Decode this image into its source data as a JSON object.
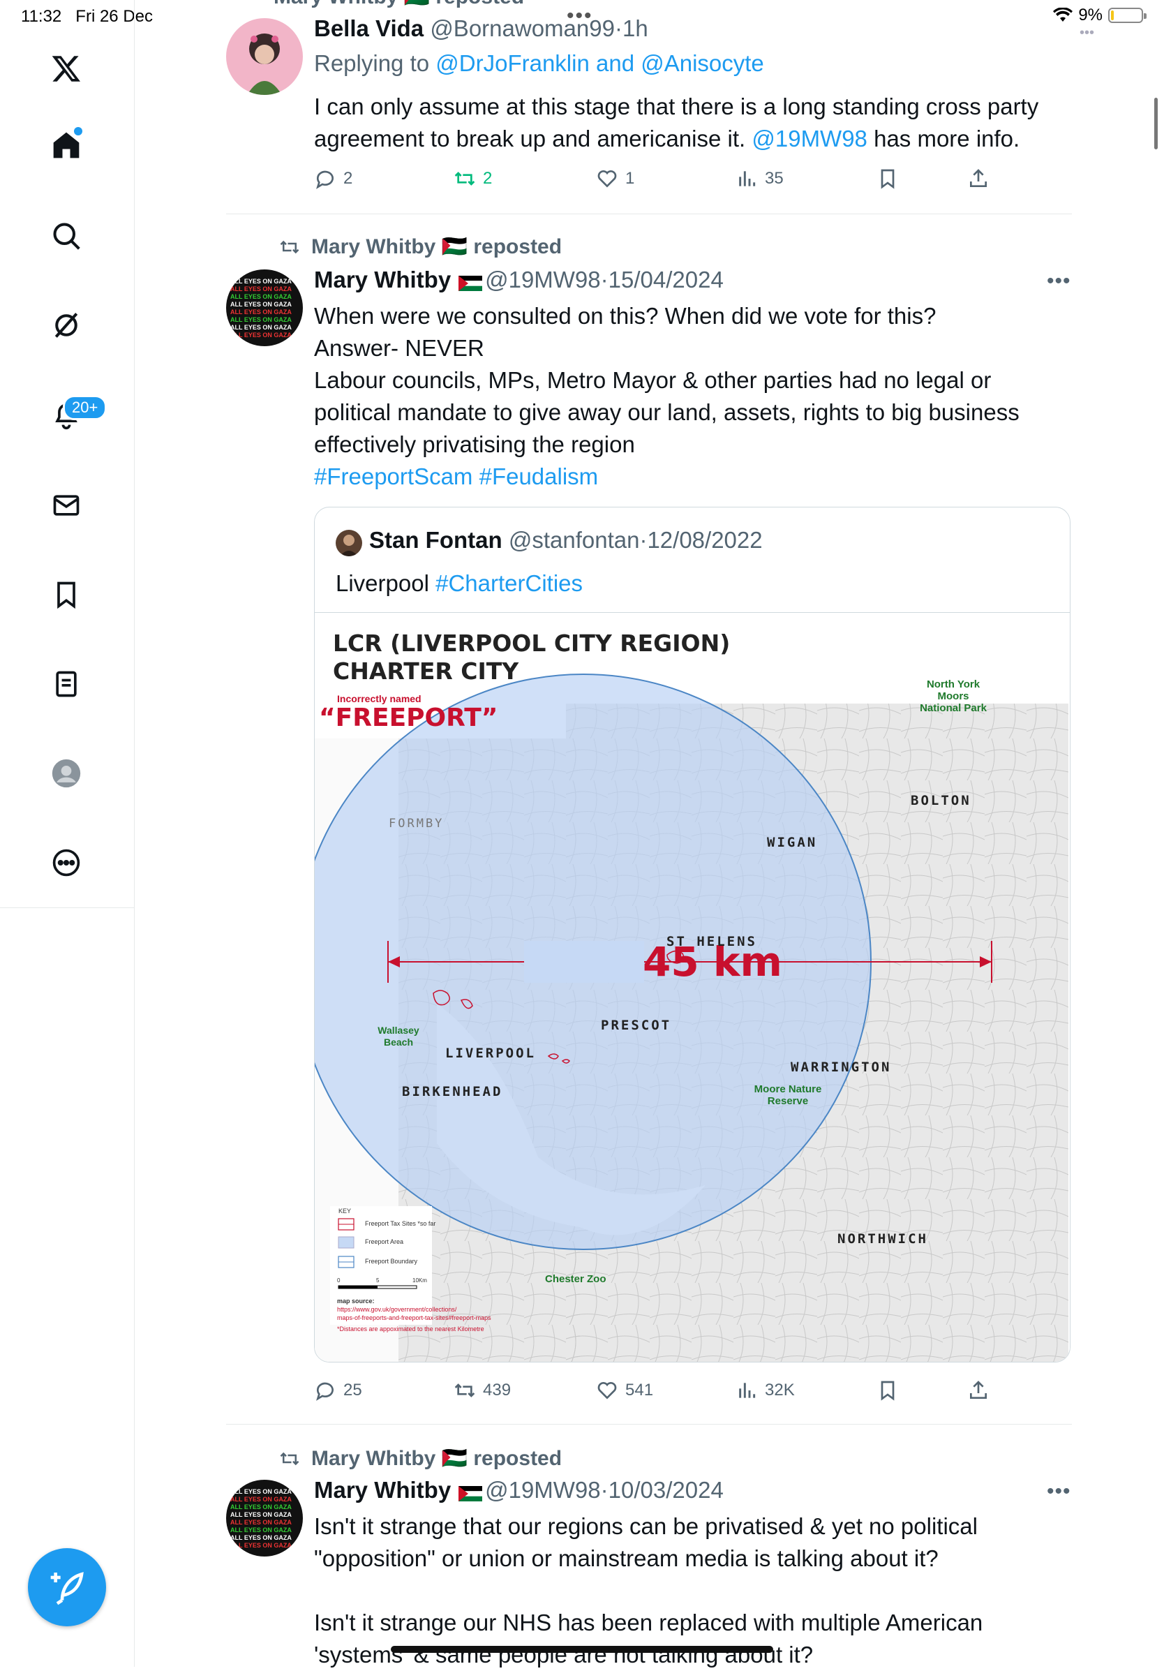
{
  "status": {
    "time": "11:32",
    "date": "Fri 26 Dec",
    "battery": "9%",
    "battery_level": 0.09
  },
  "sidebar": {
    "items": [
      "x-logo",
      "home",
      "search",
      "grok",
      "notifications",
      "messages",
      "bookmarks",
      "lists",
      "profile",
      "more"
    ],
    "notification_badge": "20+"
  },
  "tweets": [
    {
      "repost_label": "Mary Whitby 🇵🇸 reposted",
      "name": "Bella Vida",
      "handle": "@Bornawoman99",
      "time": "1h",
      "replying_prefix": "Replying to",
      "replying_to": "@DrJoFranklin and @Anisocyte",
      "text_1": "I can only assume at this stage that there is a long standing cross party",
      "text_2a": "agreement to break up and americanise it.",
      "text_2_link": "@19MW98",
      "text_2b": "has more info.",
      "replies": "2",
      "reposts": "2",
      "likes": "1",
      "views": "35"
    },
    {
      "repost_label": "Mary Whitby 🇵🇸 reposted",
      "name": "Mary Whitby",
      "handle": "@19MW98",
      "time": "15/04/2024",
      "lines": [
        "When were we consulted on this? When did we vote for this?",
        "Answer- NEVER",
        "Labour councils, MPs, Metro Mayor & other parties had no legal or",
        "political mandate to give away our land, assets, rights to big business",
        "effectively privatising the region"
      ],
      "hashtags": "#FreeportScam #Feudalism",
      "quote": {
        "name": "Stan Fontan",
        "handle": "@stanfontan",
        "time": "12/08/2022",
        "text": "Liverpool",
        "hashtag": "#CharterCities",
        "map": {
          "title_1": "LCR (LIVERPOOL CITY REGION)",
          "title_2": "CHARTER CITY",
          "incorrect": "Incorrectly named",
          "freeport": "“FREEPORT”",
          "distance": "45 km",
          "places": {
            "formby": "FORMBY",
            "wigan": "WIGAN",
            "bolton": "BOLTON",
            "st_helens": "ST HELENS",
            "prescot": "PRESCOT",
            "liverpool": "LIVERPOOL",
            "birkenhead": "BIRKENHEAD",
            "warrington": "WARRINGTON",
            "northwich": "NORTHWICH"
          },
          "green_places": {
            "north_york_1": "North York",
            "north_york_2": "Moors",
            "north_york_3": "National Park",
            "wallasey_1": "Wallasey",
            "wallasey_2": "Beach",
            "moore_1": "Moore Nature",
            "moore_2": "Reserve",
            "chester": "Chester Zoo"
          },
          "key": {
            "title": "KEY",
            "tax_sites": "Freeport Tax Sites *so far",
            "area": "Freeport Area",
            "boundary": "Freeport Boundary",
            "scale_0": "0",
            "scale_5": "5",
            "scale_10": "10Km"
          },
          "source_label": "map source:",
          "source_1": "https://www.gov.uk/government/collections/",
          "source_2": "maps-of-freeports-and-freeport-tax-sites#freeport-maps",
          "footnote": "*Distances are appoximated to the nearest Kilometre"
        }
      },
      "replies": "25",
      "reposts": "439",
      "likes": "541",
      "views": "32K"
    },
    {
      "repost_label": "Mary Whitby 🇵🇸 reposted",
      "name": "Mary Whitby",
      "handle": "@19MW98",
      "time": "10/03/2024",
      "lines": [
        "Isn't it strange that our regions can be privatised & yet no political",
        "\"opposition\" or union or mainstream media is talking about it?",
        "",
        "Isn't it strange our NHS has been replaced with multiple American",
        "'systems' & same people are not talking about it?"
      ]
    }
  ],
  "colors": {
    "accent": "#1d9bf0",
    "text": "#0f1419",
    "muted": "#536471",
    "repost_green": "#00ba7c",
    "map_red": "#c8102e",
    "map_green": "#1f7a2c"
  }
}
